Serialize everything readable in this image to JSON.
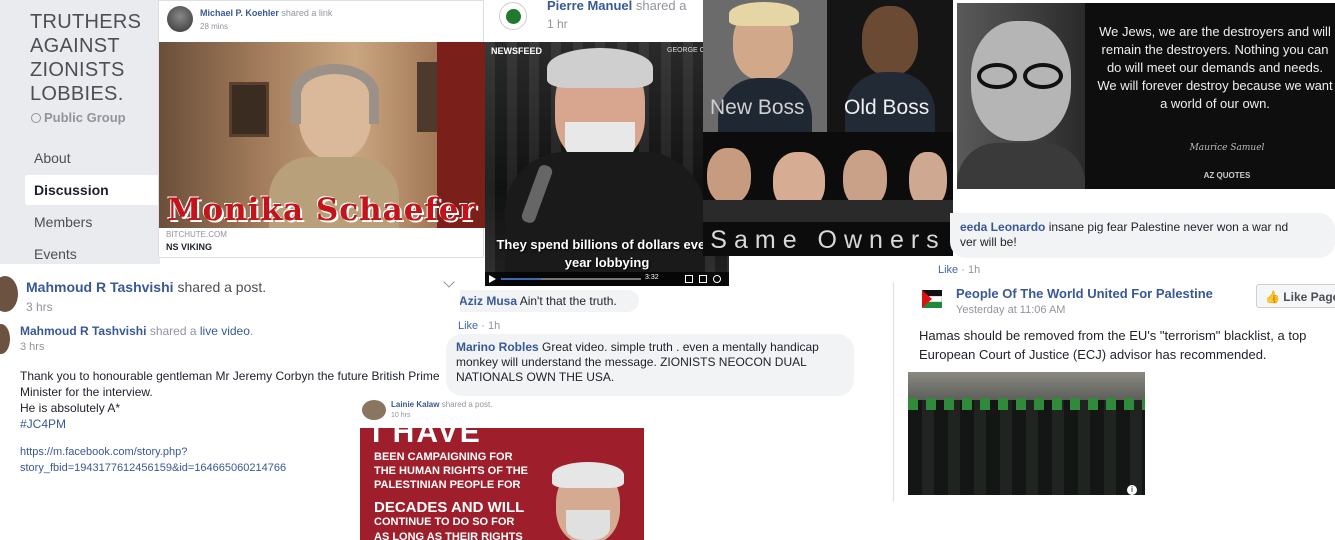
{
  "group": {
    "title": "TRUTHERS AGAINST ZIONISTS LOBBIES.",
    "title_lines": [
      "TRUTHERS",
      "AGAINST",
      "ZIONISTS",
      "LOBBIES."
    ],
    "privacy": "Public Group",
    "nav": [
      "About",
      "Discussion",
      "Members",
      "Events"
    ],
    "active_nav": "Discussion"
  },
  "post_kaehler": {
    "author": "Michael P. Koehler",
    "action": "shared a link",
    "time": "28 mins",
    "video_caption": "Monika Schaefer",
    "link_domain": "BITCHUTE.COM",
    "link_title": "NS VIKING"
  },
  "post_manuel": {
    "author": "Pierre Manuel",
    "action": "shared a",
    "time": "1 hr",
    "video_tag": "NEWSFEED",
    "video_corner": "GEORGE C",
    "subtitle": "They spend billions of dollars every year lobbying",
    "player_time": "3:32"
  },
  "meme_boss": {
    "new": "New Boss",
    "old": "Old Boss",
    "same": "Same Owners"
  },
  "quote_card": {
    "quote": "We Jews, we are the destroyers and will remain the destroyers. Nothing you can do will meet our demands and needs. We will forever destroy because we want a world of our own.",
    "attribution": "Maurice Samuel",
    "brand": "AZ QUOTES"
  },
  "comment_leonardo": {
    "author": "eeda Leonardo",
    "text": "insane pig fear Palestine never won a war nd",
    "text2": "ver will be!",
    "like": "Like",
    "time": "1h"
  },
  "comment_musa": {
    "author": "Aziz Musa",
    "text": "Ain't that the truth.",
    "like": "Like",
    "time": "1h"
  },
  "comment_robles": {
    "author": "Marino Robles",
    "text": "Great video. simple truth . even a mentally handicap monkey will understand the message. ZIONISTS NEOCON DUAL NATIONALS OWN THE USA."
  },
  "post_tashvishi_1": {
    "author": "Mahmoud R Tashvishi",
    "action": "shared a post.",
    "time": "3 hrs"
  },
  "post_tashvishi_2": {
    "author": "Mahmoud R Tashvishi",
    "action_prefix": "shared a",
    "action_link": "live video",
    "time": "3 hrs",
    "body": [
      "Thank you to honourable gentleman Mr Jeremy Corbyn the future British Prime",
      "Minister for the interview.",
      "He is absolutely A*",
      "#JC4PM"
    ],
    "url": [
      "https://m.facebook.com/story.php?",
      "story_fbid=1943177612456159&id=164665060214766"
    ]
  },
  "post_kalaw": {
    "author": "Lainie Kalaw",
    "action": "shared a post.",
    "time": "10 hrs",
    "poster_big": "I HAVE",
    "poster_lines": [
      "BEEN CAMPAIGNING FOR",
      "THE HUMAN RIGHTS OF THE",
      "PALESTINIAN PEOPLE FOR"
    ],
    "poster_lines2": [
      "DECADES AND WILL",
      "CONTINUE TO DO SO FOR",
      "AS LONG AS THEIR RIGHTS"
    ]
  },
  "post_palestine": {
    "page": "People Of The World United For Palestine",
    "time": "Yesterday at 11:06 AM",
    "like_page": "Like Page",
    "text": "Hamas should be removed from the EU's \"terrorism\" blacklist, a top European Court of Justice (ECJ) advisor has recommended."
  }
}
